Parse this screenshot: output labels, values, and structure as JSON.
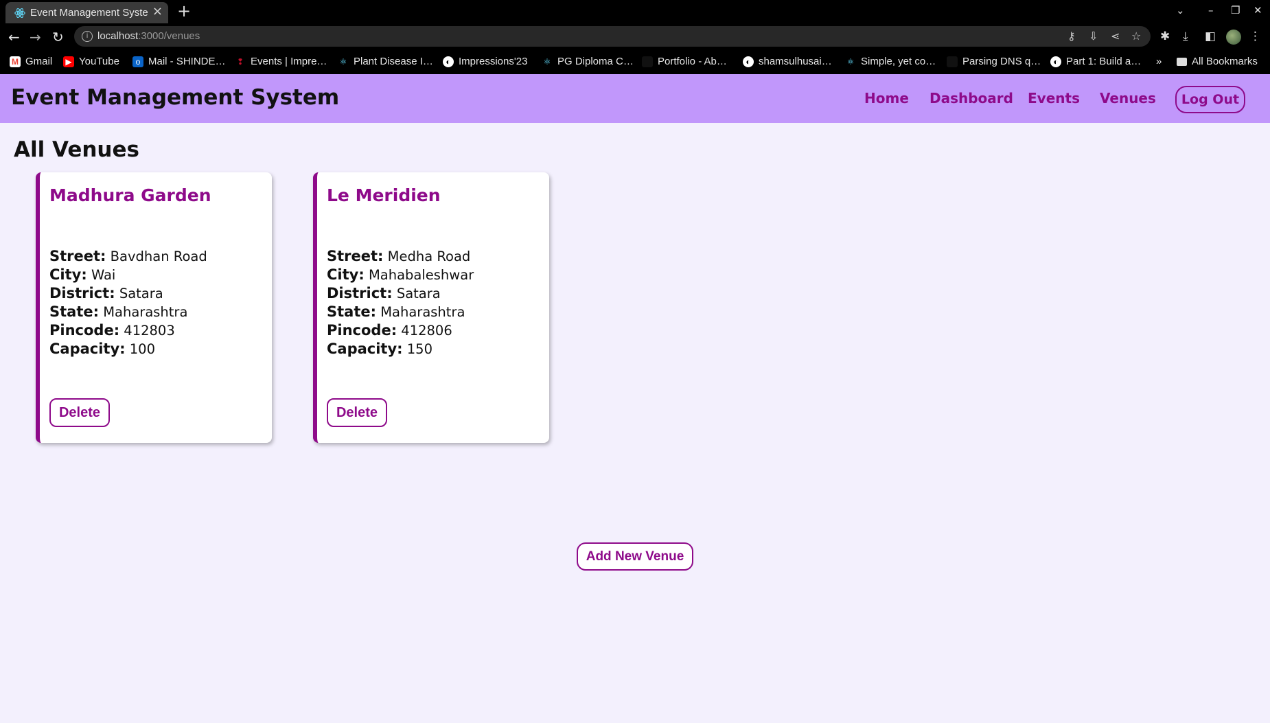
{
  "browser": {
    "tab_title": "Event Management System",
    "new_tab_icon": "plus-icon",
    "url_host": "localhost",
    "url_rest": ":3000/venues",
    "bookmarks": [
      {
        "label": "Gmail",
        "icon": "gmail-icon",
        "color": "#ea4335"
      },
      {
        "label": "YouTube",
        "icon": "youtube-icon",
        "color": "#ff0000"
      },
      {
        "label": "Mail - SHINDE…",
        "icon": "outlook-icon",
        "color": "#0a64c8"
      },
      {
        "label": "Events | Impre…",
        "icon": "events-icon",
        "color": "#c0102a"
      },
      {
        "label": "Plant Disease I…",
        "icon": "react-icon",
        "color": "#1e6e8c"
      },
      {
        "label": "Impressions'23",
        "icon": "globe-icon",
        "color": "#555555"
      },
      {
        "label": "PG Diploma C…",
        "icon": "react-icon",
        "color": "#1e6e8c"
      },
      {
        "label": "Portfolio - Ab…",
        "icon": "portfolio-icon",
        "color": "#222222"
      },
      {
        "label": "shamsulhusai…",
        "icon": "globe-icon",
        "color": "#555555"
      },
      {
        "label": "Simple, yet co…",
        "icon": "react-icon",
        "color": "#1e6e8c"
      },
      {
        "label": "Parsing DNS q…",
        "icon": "page-icon",
        "color": "#222222"
      },
      {
        "label": "Part 1: Build a…",
        "icon": "globe-icon",
        "color": "#555555"
      }
    ],
    "more_bookmarks": "»",
    "all_bookmarks": "All Bookmarks"
  },
  "navbar": {
    "brand": "Event Management System",
    "links": [
      "Home",
      "Dashboard",
      "Events",
      "Venues"
    ],
    "logout": "Log Out"
  },
  "page": {
    "title": "All Venues",
    "add_button": "Add New Venue"
  },
  "labels": {
    "street": "Street:",
    "city": "City:",
    "district": "District:",
    "state": "State:",
    "pincode": "Pincode:",
    "capacity": "Capacity:",
    "delete": "Delete"
  },
  "venues": [
    {
      "name": "Madhura Garden",
      "street": "Bavdhan Road",
      "city": "Wai",
      "district": "Satara",
      "state": "Maharashtra",
      "pincode": "412803",
      "capacity": "100"
    },
    {
      "name": "Le Meridien",
      "street": "Medha Road",
      "city": "Mahabaleshwar",
      "district": "Satara",
      "state": "Maharashtra",
      "pincode": "412806",
      "capacity": "150"
    }
  ],
  "colors": {
    "accent": "#8e0a8a",
    "navbar": "#c197fb",
    "background": "#f3f0fd"
  }
}
